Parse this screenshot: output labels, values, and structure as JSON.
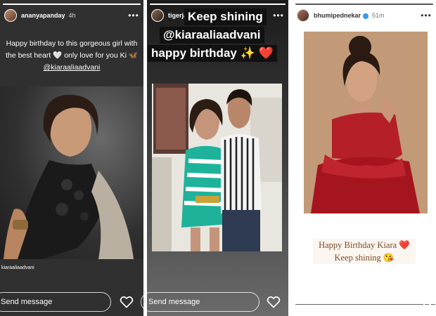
{
  "story1": {
    "username": "ananyapanday",
    "time": "4h",
    "caption_text": "Happy birthday to this gorgeous girl with the best heart",
    "caption_text2": " only love for you Ki",
    "caption_mention": "@kiaraaliaadvani",
    "photo_tag": "kiaraaliaadvani",
    "send_placeholder": "Send message",
    "more_icon": "more-horizontal-icon",
    "heart_icon": "heart-outline-icon"
  },
  "story2": {
    "username": "tigerjackieshroff",
    "line1": "Keep shining",
    "line2": "@kiaraaliaadvani",
    "line3": "happy birthday",
    "line3_emoji": "✨",
    "line3_heart": "❤️",
    "send_placeholder": "Send message",
    "more_icon": "more-horizontal-icon",
    "heart_icon": "heart-outline-icon"
  },
  "story3": {
    "username": "bhumipednekar",
    "time": "51m",
    "greeting_line1": "Happy Birthday Kiara",
    "greeting_heart": "❤️",
    "greeting_line2": "Keep shining",
    "greeting_emoji": "😘",
    "more_icon": "more-horizontal-icon"
  },
  "colors": {
    "verified_badge": "#3897f0",
    "heart_red": "#e8243b",
    "greeting_text": "#7a4e2e"
  }
}
